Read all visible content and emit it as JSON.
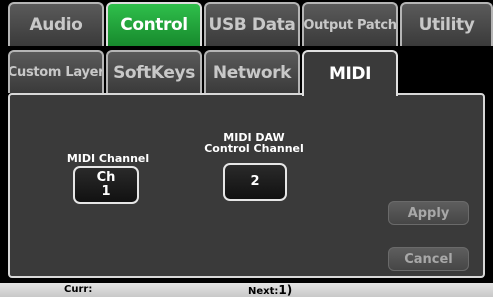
{
  "tabs_row1": [
    {
      "label": "Audio"
    },
    {
      "label": "Control"
    },
    {
      "label": "USB Data"
    },
    {
      "label": "Output Patch"
    },
    {
      "label": "Utility"
    }
  ],
  "tabs_row2": [
    {
      "label": "Custom Layer"
    },
    {
      "label": "SoftKeys"
    },
    {
      "label": "Network"
    },
    {
      "label": "MIDI"
    }
  ],
  "midi_channel": {
    "label": "MIDI Channel",
    "value_line1": "Ch",
    "value_line2": "1"
  },
  "midi_daw": {
    "label_line1": "MIDI DAW",
    "label_line2": "Control Channel",
    "value": "2"
  },
  "buttons": {
    "apply": "Apply",
    "cancel": "Cancel"
  },
  "status": {
    "curr_label": "Curr:",
    "next_label": "Next:",
    "next_value": "1)"
  },
  "colors": {
    "active_tab": "#1f9e38",
    "panel_bg": "#3a3a3a",
    "tab_bg": "#4a4a4a"
  }
}
